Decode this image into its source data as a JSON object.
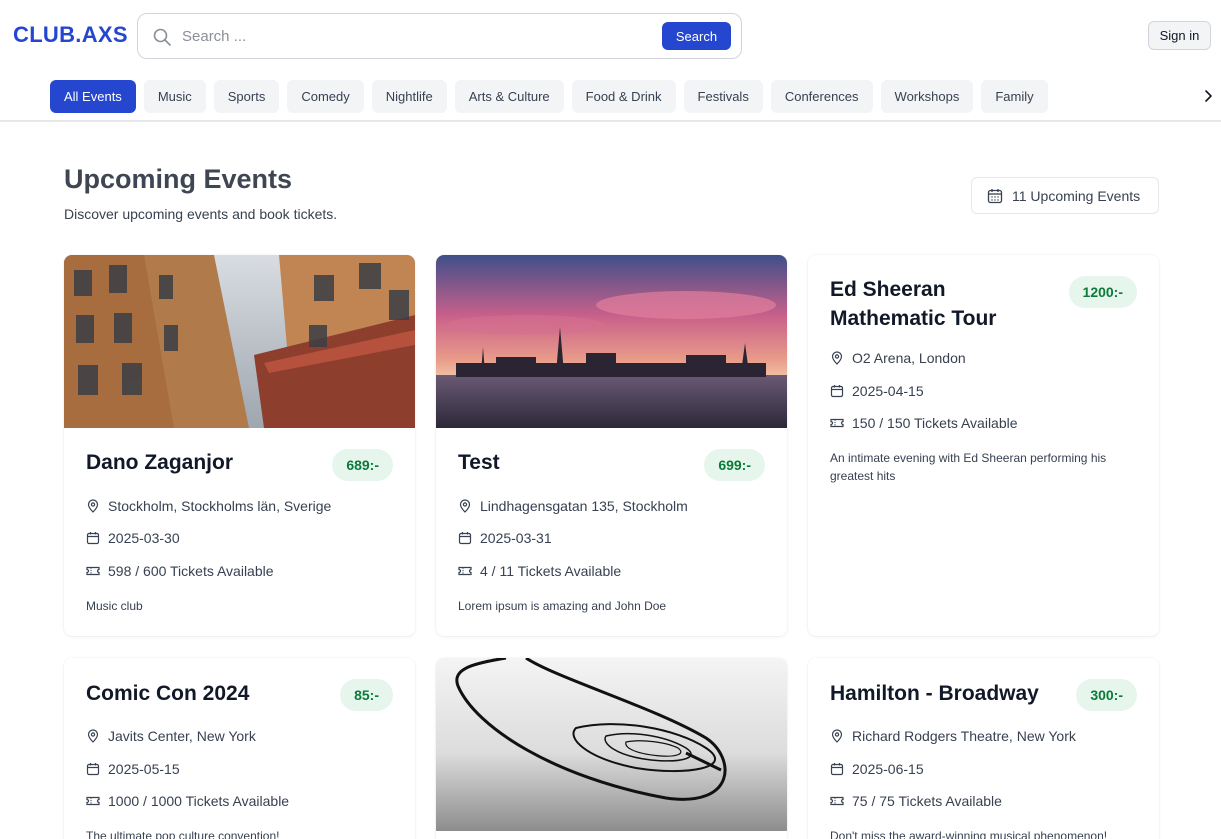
{
  "header": {
    "logo": "CLUB.AXS",
    "search_placeholder": "Search ...",
    "search_button": "Search",
    "signin_button": "Sign in"
  },
  "categories": [
    "All Events",
    "Music",
    "Sports",
    "Comedy",
    "Nightlife",
    "Arts & Culture",
    "Food & Drink",
    "Festivals",
    "Conferences",
    "Workshops",
    "Family"
  ],
  "active_category": "All Events",
  "section": {
    "title": "Upcoming Events",
    "subtitle": "Discover upcoming events and book tickets.",
    "count_label": "11 Upcoming Events"
  },
  "events": [
    {
      "title": "Dano Zaganjor",
      "price": "689:-",
      "location": "Stockholm, Stockholms län, Sverige",
      "date": "2025-03-30",
      "tickets": "598 / 600 Tickets Available",
      "description": "Music club",
      "image": "building-facade"
    },
    {
      "title": "Test",
      "price": "699:-",
      "location": "Lindhagensgatan 135, Stockholm",
      "date": "2025-03-31",
      "tickets": "4 / 11 Tickets Available",
      "description": "Lorem ipsum is amazing and John Doe",
      "image": "city-sunset"
    },
    {
      "title": "Ed Sheeran Mathematic Tour",
      "price": "1200:-",
      "location": "O2 Arena, London",
      "date": "2025-04-15",
      "tickets": "150 / 150 Tickets Available",
      "description": "An intimate evening with Ed Sheeran performing his greatest hits",
      "image": ""
    },
    {
      "title": "Comic Con 2024",
      "price": "85:-",
      "location": "Javits Center, New York",
      "date": "2025-05-15",
      "tickets": "1000 / 1000 Tickets Available",
      "description": "The ultimate pop culture convention!",
      "image": ""
    },
    {
      "title": "",
      "price": "",
      "location": "",
      "date": "",
      "tickets": "",
      "description": "",
      "image": "abstract-sketch"
    },
    {
      "title": "Hamilton - Broadway",
      "price": "300:-",
      "location": "Richard Rodgers Theatre, New York",
      "date": "2025-06-15",
      "tickets": "75 / 75 Tickets Available",
      "description": "Don't miss the award-winning musical phenomenon!",
      "image": ""
    }
  ],
  "colors": {
    "brand": "#2547d0",
    "price_bg": "#e6f6ec",
    "price_text": "#0b7a3b"
  }
}
